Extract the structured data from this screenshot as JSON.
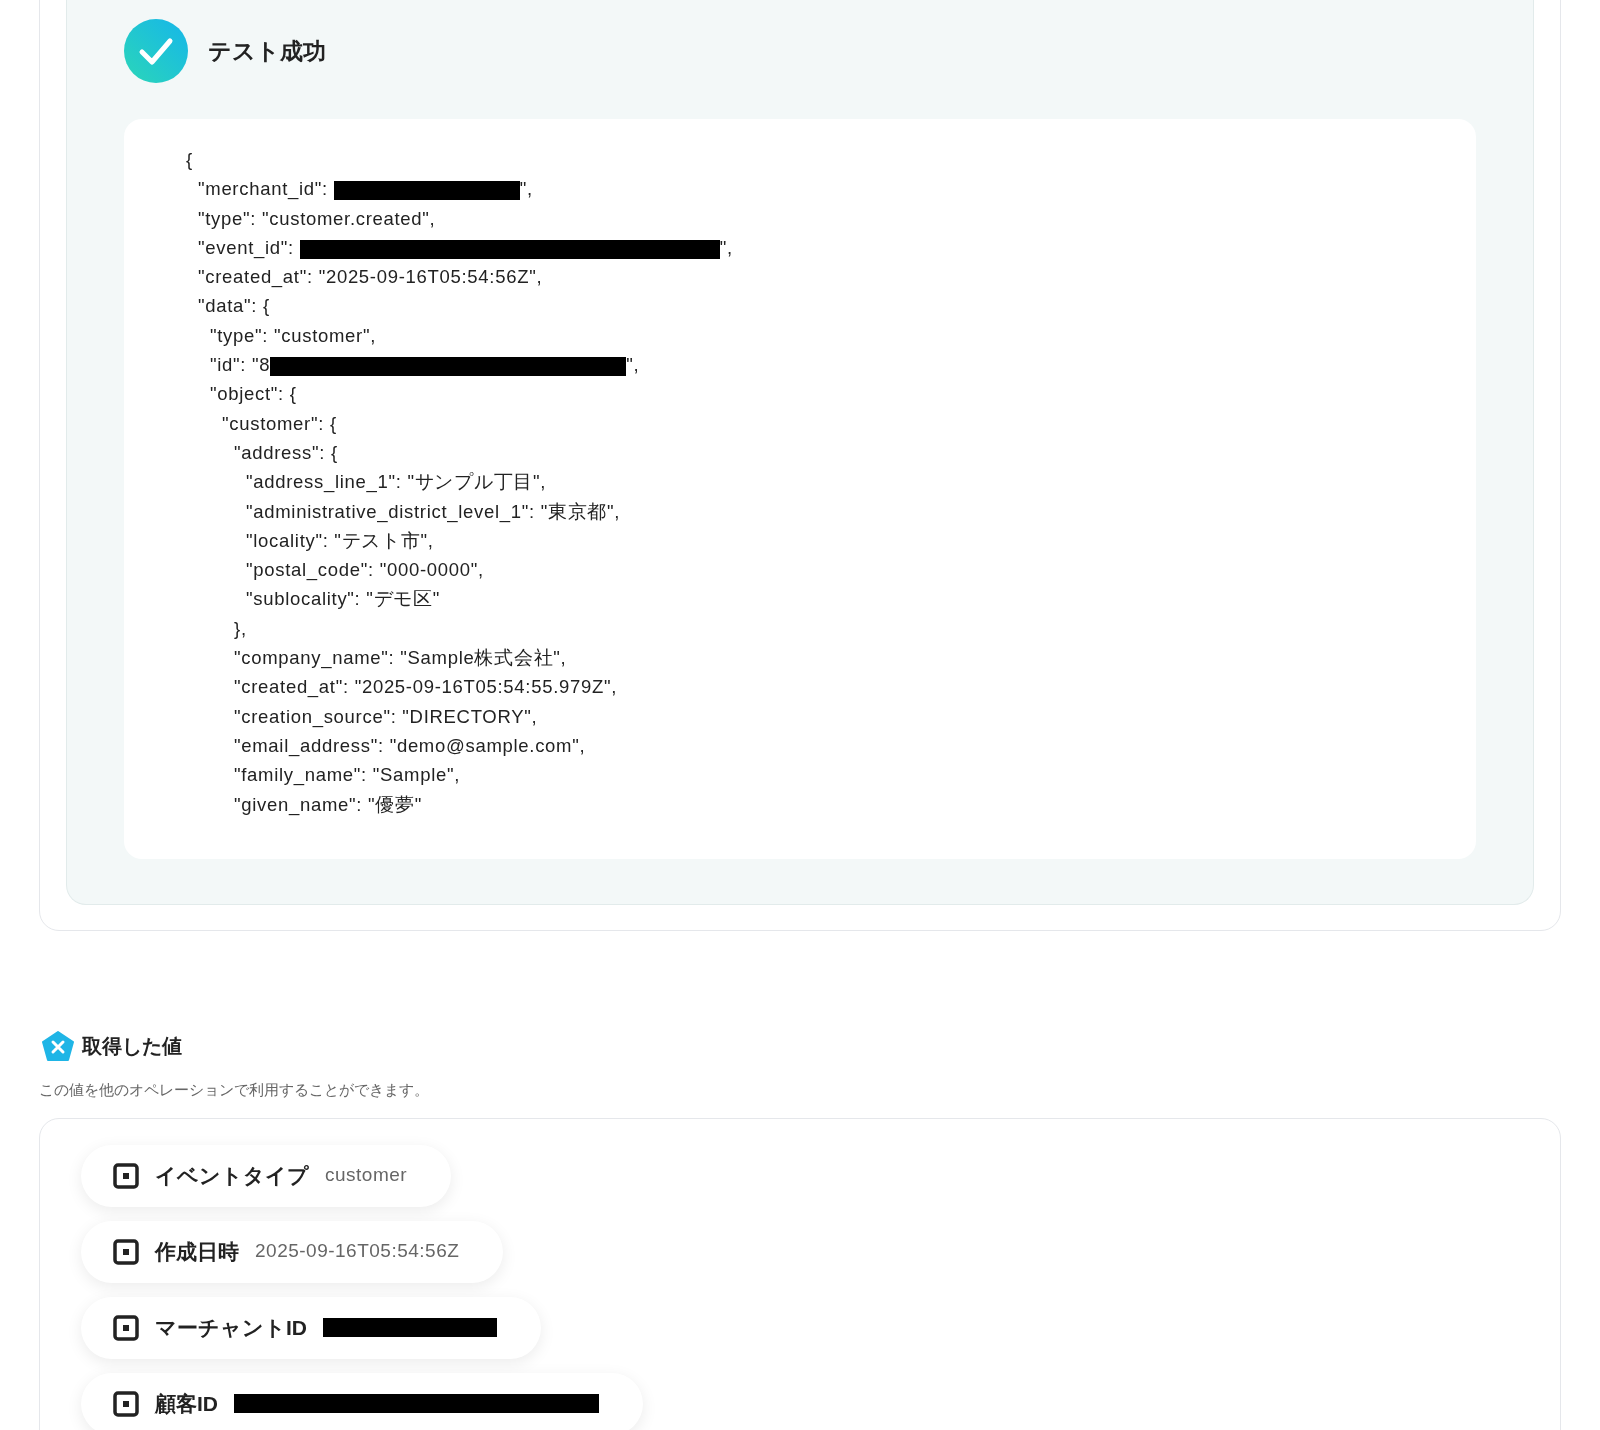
{
  "test_result": {
    "title": "テスト成功",
    "code_lines": [
      {
        "text": "{",
        "children": [
          {
            "text": "\"merchant_id\": ",
            "redacted": true,
            "after": "\","
          },
          {
            "text": "\"type\": \"customer.created\","
          },
          {
            "text": "\"event_id\": ",
            "redacted": true,
            "after": "\","
          },
          {
            "text": "\"created_at\": \"2025-09-16T05:54:56Z\","
          },
          {
            "text": "\"data\": {",
            "children": [
              {
                "text": "\"type\": \"customer\","
              },
              {
                "text": "\"id\": \"8",
                "redacted": true,
                "after": "\","
              },
              {
                "text": "\"object\": {",
                "children": [
                  {
                    "text": "\"customer\": {",
                    "children": [
                      {
                        "text": "\"address\": {",
                        "children": [
                          {
                            "text": "\"address_line_1\": \"サンプル丁目\","
                          },
                          {
                            "text": "\"administrative_district_level_1\": \"東京都\","
                          },
                          {
                            "text": "\"locality\": \"テスト市\","
                          },
                          {
                            "text": "\"postal_code\": \"000-0000\","
                          },
                          {
                            "text": "\"sublocality\": \"デモ区\""
                          }
                        ]
                      },
                      {
                        "text": "},"
                      },
                      {
                        "text": "\"company_name\": \"Sample株式会社\","
                      },
                      {
                        "text": "\"created_at\": \"2025-09-16T05:54:55.979Z\","
                      },
                      {
                        "text": "\"creation_source\": \"DIRECTORY\","
                      },
                      {
                        "text": "\"email_address\": \"demo@sample.com\","
                      },
                      {
                        "text": "\"family_name\": \"Sample\","
                      },
                      {
                        "text": "\"given_name\": \"優夢\""
                      }
                    ]
                  }
                ]
              }
            ]
          }
        ]
      }
    ]
  },
  "values_section": {
    "title": "取得した値",
    "description": "この値を他のオペレーションで利用することができます。",
    "items": [
      {
        "label": "イベントタイプ",
        "kind": "text",
        "value": "customer"
      },
      {
        "label": "作成日時",
        "kind": "text",
        "value": "2025-09-16T05:54:56Z"
      },
      {
        "label": "マーチャントID",
        "kind": "redacted"
      },
      {
        "label": "顧客ID",
        "kind": "redacted"
      }
    ]
  }
}
